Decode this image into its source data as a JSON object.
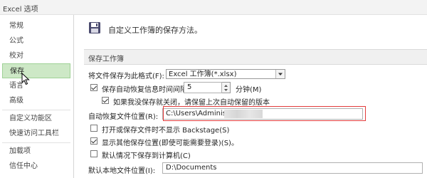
{
  "window": {
    "title": "Excel 选项"
  },
  "sidebar": {
    "items": [
      {
        "label": "常规"
      },
      {
        "label": "公式"
      },
      {
        "label": "校对"
      },
      {
        "label": "保存"
      },
      {
        "label": "语言"
      },
      {
        "label": "高级"
      },
      {
        "label": "自定义功能区"
      },
      {
        "label": "快速访问工具栏"
      },
      {
        "label": "加载项"
      },
      {
        "label": "信任中心"
      }
    ],
    "selected": "保存"
  },
  "main": {
    "header_text": "自定义工作簿的保存方法。",
    "section_title": "保存工作簿",
    "save_format": {
      "label": "将文件保存为此格式(F):",
      "value": "Excel 工作簿(*.xlsx)"
    },
    "autorecover": {
      "label": "保存自动恢复信息时间间隔(A)",
      "value": "5",
      "unit": "分钟(M)",
      "checked": true
    },
    "keep_last": {
      "label": "如果我没保存就关闭，请保留上次自动保留的版本",
      "checked": true
    },
    "autorecover_location": {
      "label": "自动恢复文件位置(R):",
      "value": "C:\\Users\\Administ"
    },
    "backstage": {
      "label": "打开或保存文件时不显示 Backstage(S)",
      "checked": false
    },
    "show_other": {
      "label": "显示其他保存位置(即使可能需要登录)(S)。",
      "checked": true
    },
    "default_computer": {
      "label": "默认情况下保存到计算机(C)",
      "checked": false
    },
    "default_local": {
      "label": "默认本地文件位置(I):",
      "value": "D:\\Documents"
    }
  }
}
